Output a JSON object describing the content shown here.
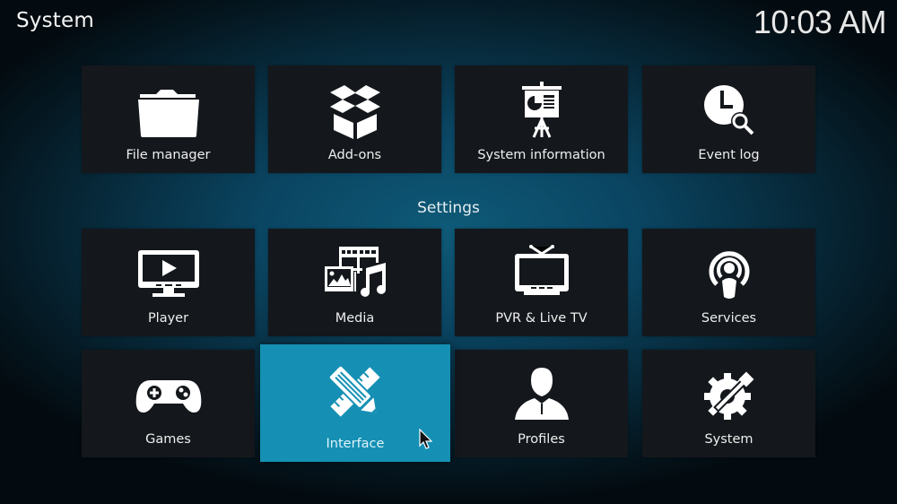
{
  "header": {
    "title": "System",
    "clock": "10:03 AM"
  },
  "top_row": [
    {
      "label": "File manager",
      "icon": "folder-icon"
    },
    {
      "label": "Add-ons",
      "icon": "open-box-icon"
    },
    {
      "label": "System information",
      "icon": "presentation-board-icon"
    },
    {
      "label": "Event log",
      "icon": "clock-search-icon"
    }
  ],
  "settings": {
    "heading": "Settings",
    "items": [
      {
        "label": "Player",
        "icon": "tv-play-icon"
      },
      {
        "label": "Media",
        "icon": "media-film-photo-music-icon"
      },
      {
        "label": "PVR & Live TV",
        "icon": "tv-antenna-icon"
      },
      {
        "label": "Services",
        "icon": "broadcast-person-icon"
      },
      {
        "label": "Games",
        "icon": "gamepad-icon"
      },
      {
        "label": "Interface",
        "icon": "pencil-ruler-icon",
        "focused": true
      },
      {
        "label": "Profiles",
        "icon": "user-silhouette-icon"
      },
      {
        "label": "System",
        "icon": "gear-wrench-icon"
      }
    ]
  },
  "colors": {
    "focus_accent": "#1590b4",
    "tile_background": "#14181c",
    "text": "#eeeeee"
  }
}
